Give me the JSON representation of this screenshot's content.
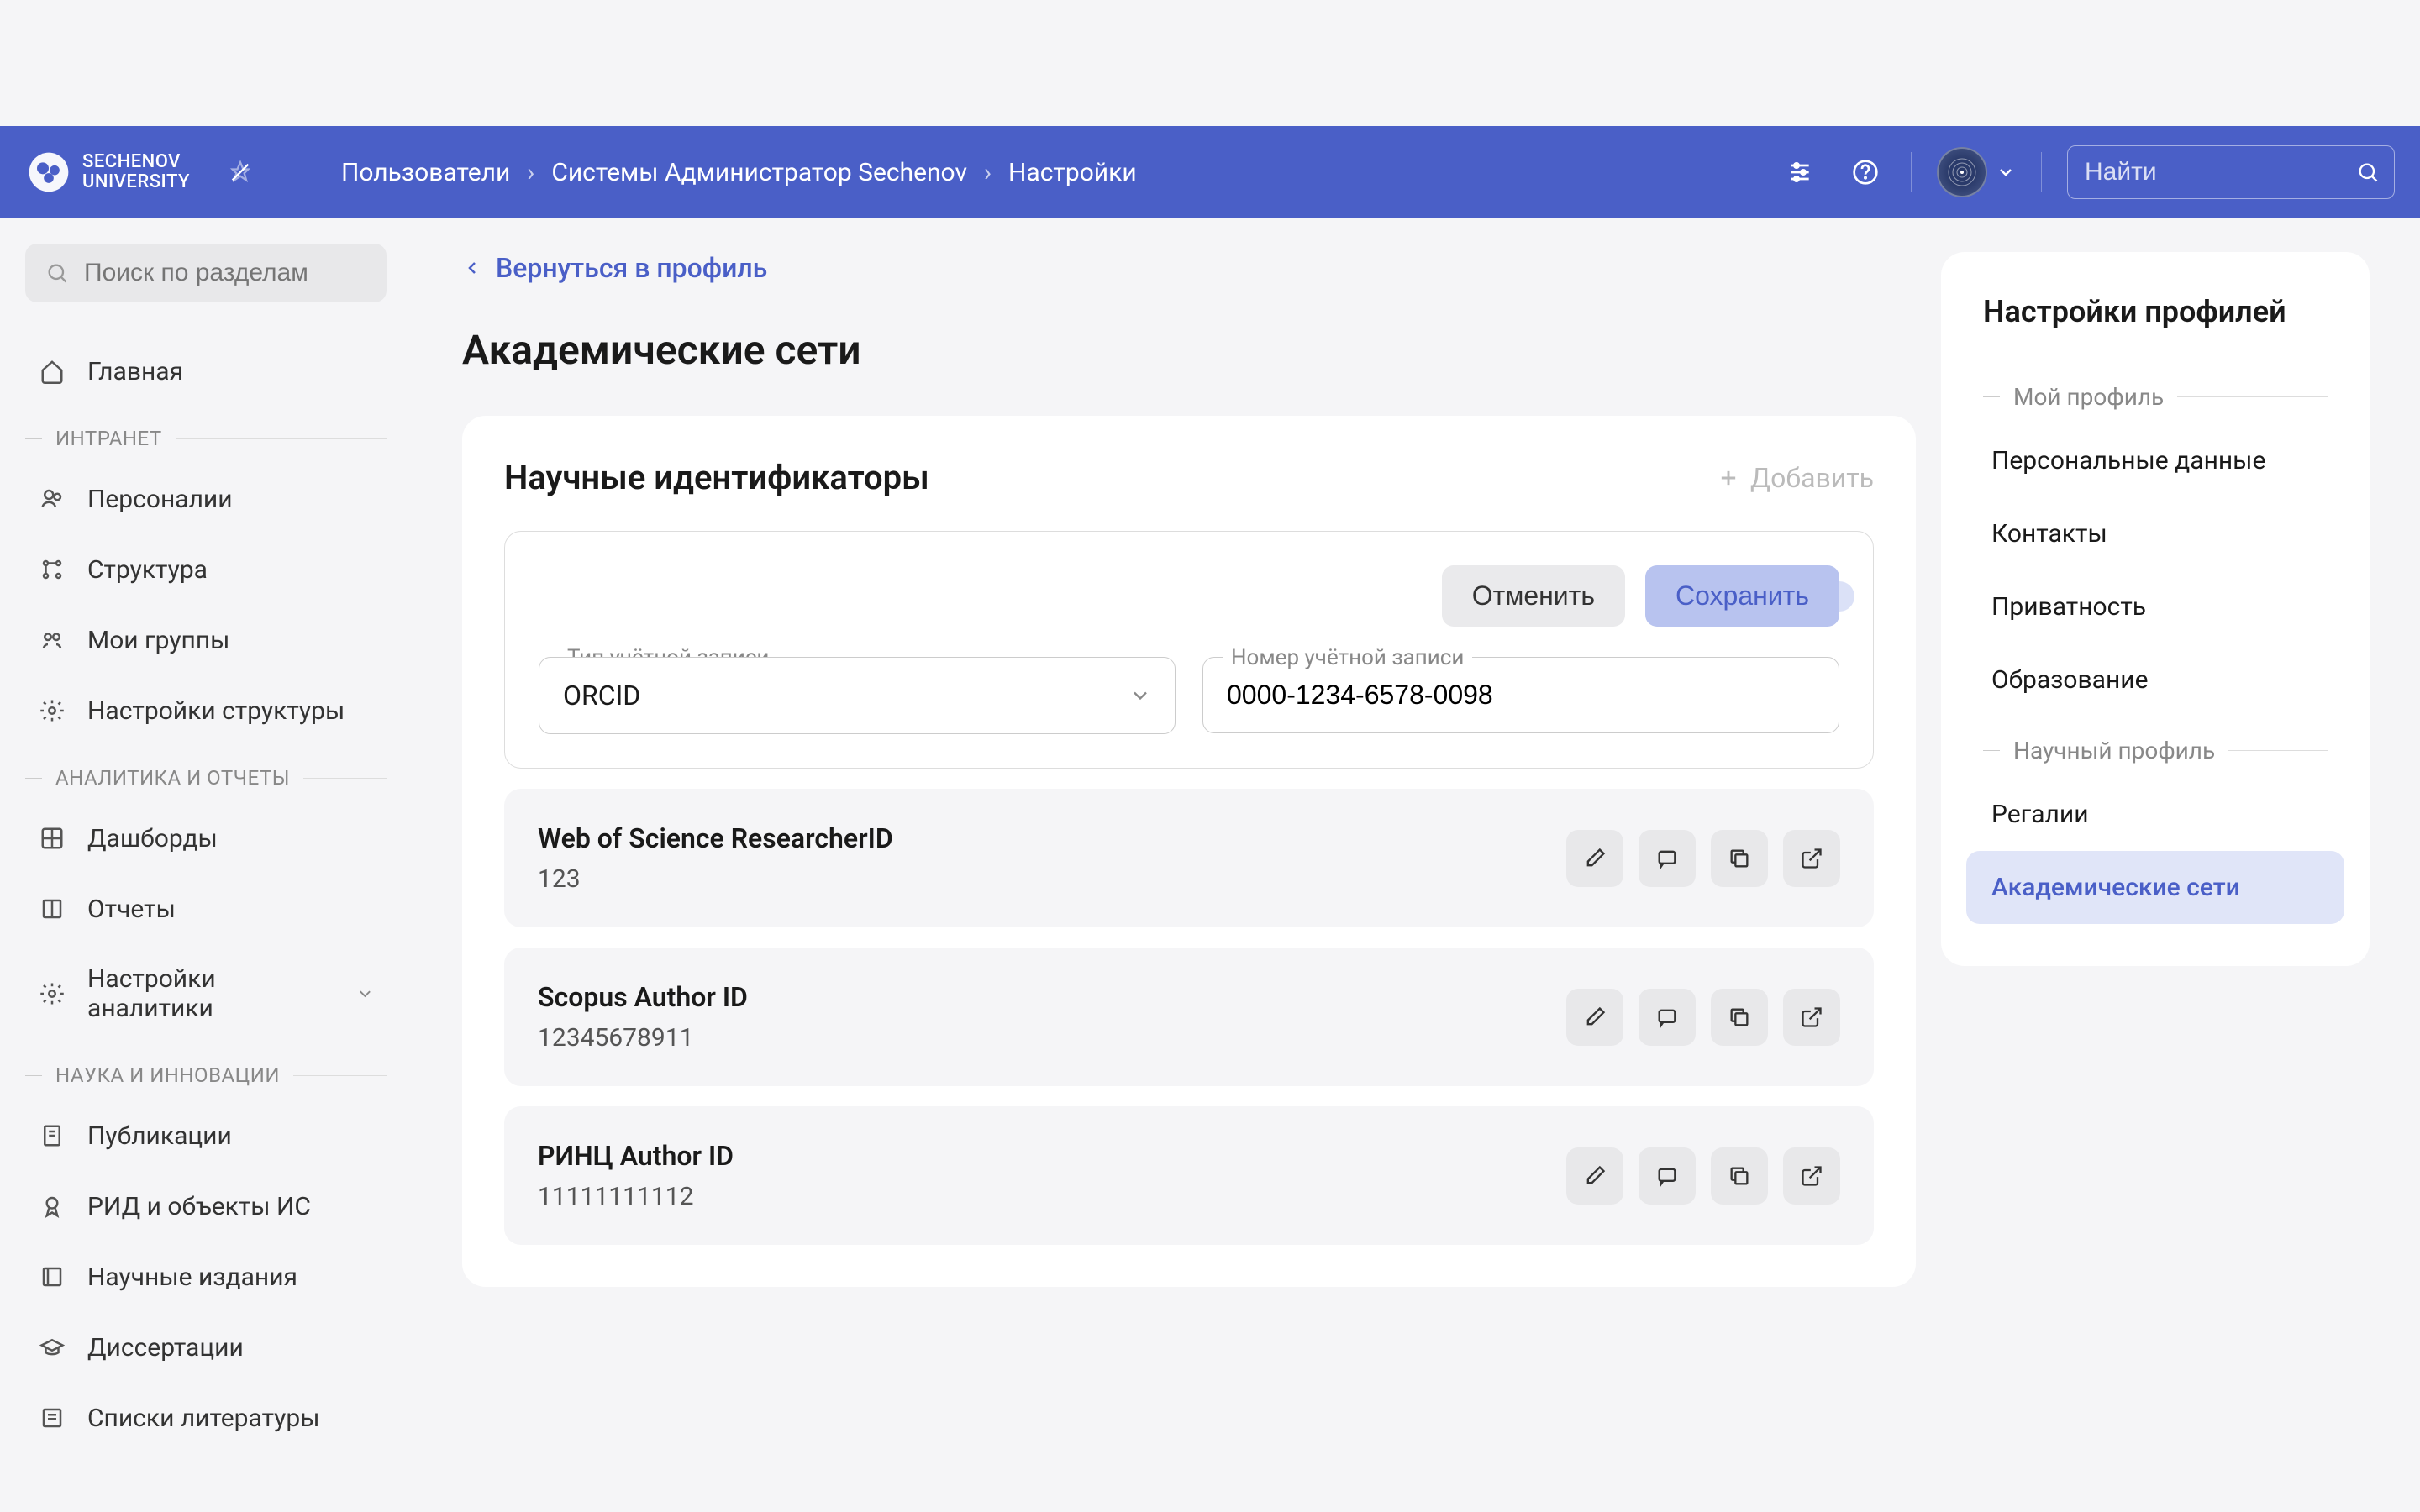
{
  "header": {
    "logo_line1": "SECHENOV",
    "logo_line2": "UNIVERSITY",
    "breadcrumbs": [
      "Пользователи",
      "Системы Администратор Sechenov",
      "Настройки"
    ],
    "search_placeholder": "Найти"
  },
  "sidebar": {
    "search_placeholder": "Поиск по разделам",
    "home": "Главная",
    "sections": [
      {
        "label": "ИНТРАНЕТ",
        "items": [
          "Персоналии",
          "Структура",
          "Мои группы",
          "Настройки структуры"
        ]
      },
      {
        "label": "АНАЛИТИКА И ОТЧЕТЫ",
        "items": [
          "Дашборды",
          "Отчеты",
          "Настройки аналитики"
        ]
      },
      {
        "label": "НАУКА И ИННОВАЦИИ",
        "items": [
          "Публикации",
          "РИД и объекты ИС",
          "Научные издания",
          "Диссертации",
          "Списки литературы"
        ]
      }
    ]
  },
  "main": {
    "back_label": "Вернуться в профиль",
    "page_title": "Академические сети",
    "card_title": "Научные идентификаторы",
    "add_label": "Добавить",
    "cancel_label": "Отменить",
    "save_label": "Сохранить",
    "account_type_label": "Тип учётной записи",
    "account_type_value": "ORCID",
    "account_number_label": "Номер учётной записи",
    "account_number_value": "0000-1234-6578-0098",
    "ids": [
      {
        "name": "Web of Science ResearcherID",
        "value": "123"
      },
      {
        "name": "Scopus Author ID",
        "value": "12345678911"
      },
      {
        "name": "РИНЦ Author ID",
        "value": "11111111112"
      }
    ]
  },
  "right_panel": {
    "title": "Настройки профилей",
    "section1": "Мой профиль",
    "items1": [
      "Персональные данные",
      "Контакты",
      "Приватность",
      "Образование"
    ],
    "section2": "Научный профиль",
    "items2": [
      "Регалии",
      "Академические сети"
    ],
    "active_index": 1
  }
}
